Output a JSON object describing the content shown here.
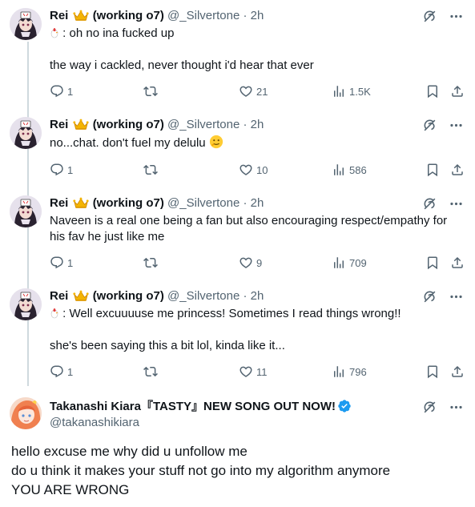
{
  "colors": {
    "text": "#0f1419",
    "muted": "#536471",
    "verified": "#1d9bf0",
    "thread_line": "#cfd9de"
  },
  "tweets": [
    {
      "display_name": "Rei",
      "name_suffix": "(working o7)",
      "handle": "@_Silvertone",
      "time": "2h",
      "lines": [
        " : oh no ina fucked up",
        "",
        "the way i cackled, never thought i'd hear that ever"
      ],
      "has_leading_emoji": true,
      "replies": "1",
      "retweets": "",
      "likes": "21",
      "views": "1.5K"
    },
    {
      "display_name": "Rei",
      "name_suffix": "(working o7)",
      "handle": "@_Silvertone",
      "time": "2h",
      "lines": [
        "no...chat. don't fuel my delulu"
      ],
      "has_trailing_emoji": true,
      "replies": "1",
      "retweets": "",
      "likes": "10",
      "views": "586"
    },
    {
      "display_name": "Rei",
      "name_suffix": "(working o7)",
      "handle": "@_Silvertone",
      "time": "2h",
      "lines": [
        "Naveen is a real one being a fan but also encouraging respect/empathy for",
        "his fav he just like me"
      ],
      "replies": "1",
      "retweets": "",
      "likes": "9",
      "views": "709"
    },
    {
      "display_name": "Rei",
      "name_suffix": "(working o7)",
      "handle": "@_Silvertone",
      "time": "2h",
      "lines": [
        " : Well excuuuuse me princess! Sometimes I read things wrong!!",
        "",
        "she's been saying this a bit lol, kinda like it..."
      ],
      "has_leading_emoji": true,
      "replies": "1",
      "retweets": "",
      "likes": "11",
      "views": "796"
    }
  ],
  "main_tweet": {
    "display_name": "Takanashi Kiara『TASTY』NEW SONG OUT NOW!",
    "handle": "@takanashikiara",
    "lines": [
      "hello excuse me why did u unfollow me",
      "do u think it makes your stuff not go into my algorithm anymore",
      "YOU ARE WRONG"
    ]
  },
  "icons": {
    "reply": "reply-icon",
    "retweet": "retweet-icon",
    "like": "heart-icon",
    "views": "views-icon",
    "bookmark": "bookmark-icon",
    "share": "share-icon",
    "grok": "grok-icon",
    "more": "more-icon"
  }
}
